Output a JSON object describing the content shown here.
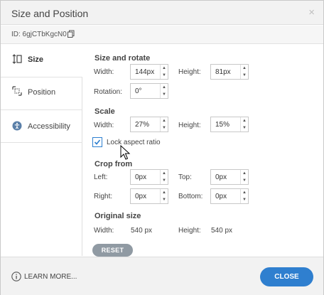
{
  "window": {
    "title": "Size and Position",
    "close_glyph": "×"
  },
  "id_bar": {
    "text": "ID: 6gjCTbKgcN0",
    "copy_icon": "copy-icon"
  },
  "sidebar": {
    "items": [
      {
        "label": "Size",
        "icon": "size-icon",
        "active": true
      },
      {
        "label": "Position",
        "icon": "position-icon",
        "active": false
      },
      {
        "label": "Accessibility",
        "icon": "accessibility-icon",
        "active": false
      }
    ]
  },
  "size_rotate": {
    "title": "Size and rotate",
    "width_label": "Width:",
    "width_value": "144px",
    "height_label": "Height:",
    "height_value": "81px",
    "rotation_label": "Rotation:",
    "rotation_value": "0°"
  },
  "scale": {
    "title": "Scale",
    "width_label": "Width:",
    "width_value": "27%",
    "height_label": "Height:",
    "height_value": "15%",
    "lock_label": "Lock aspect ratio",
    "lock_checked": true
  },
  "crop": {
    "title": "Crop from",
    "left_label": "Left:",
    "left_value": "0px",
    "top_label": "Top:",
    "top_value": "0px",
    "right_label": "Right:",
    "right_value": "0px",
    "bottom_label": "Bottom:",
    "bottom_value": "0px"
  },
  "original": {
    "title": "Original size",
    "width_label": "Width:",
    "width_value": "540 px",
    "height_label": "Height:",
    "height_value": "540 px"
  },
  "buttons": {
    "reset": "RESET",
    "learn_more": "LEARN MORE...",
    "close": "CLOSE"
  },
  "colors": {
    "accent": "#2f7fcf",
    "reset": "#909aa3",
    "titlebar": "#f2f2f2"
  }
}
